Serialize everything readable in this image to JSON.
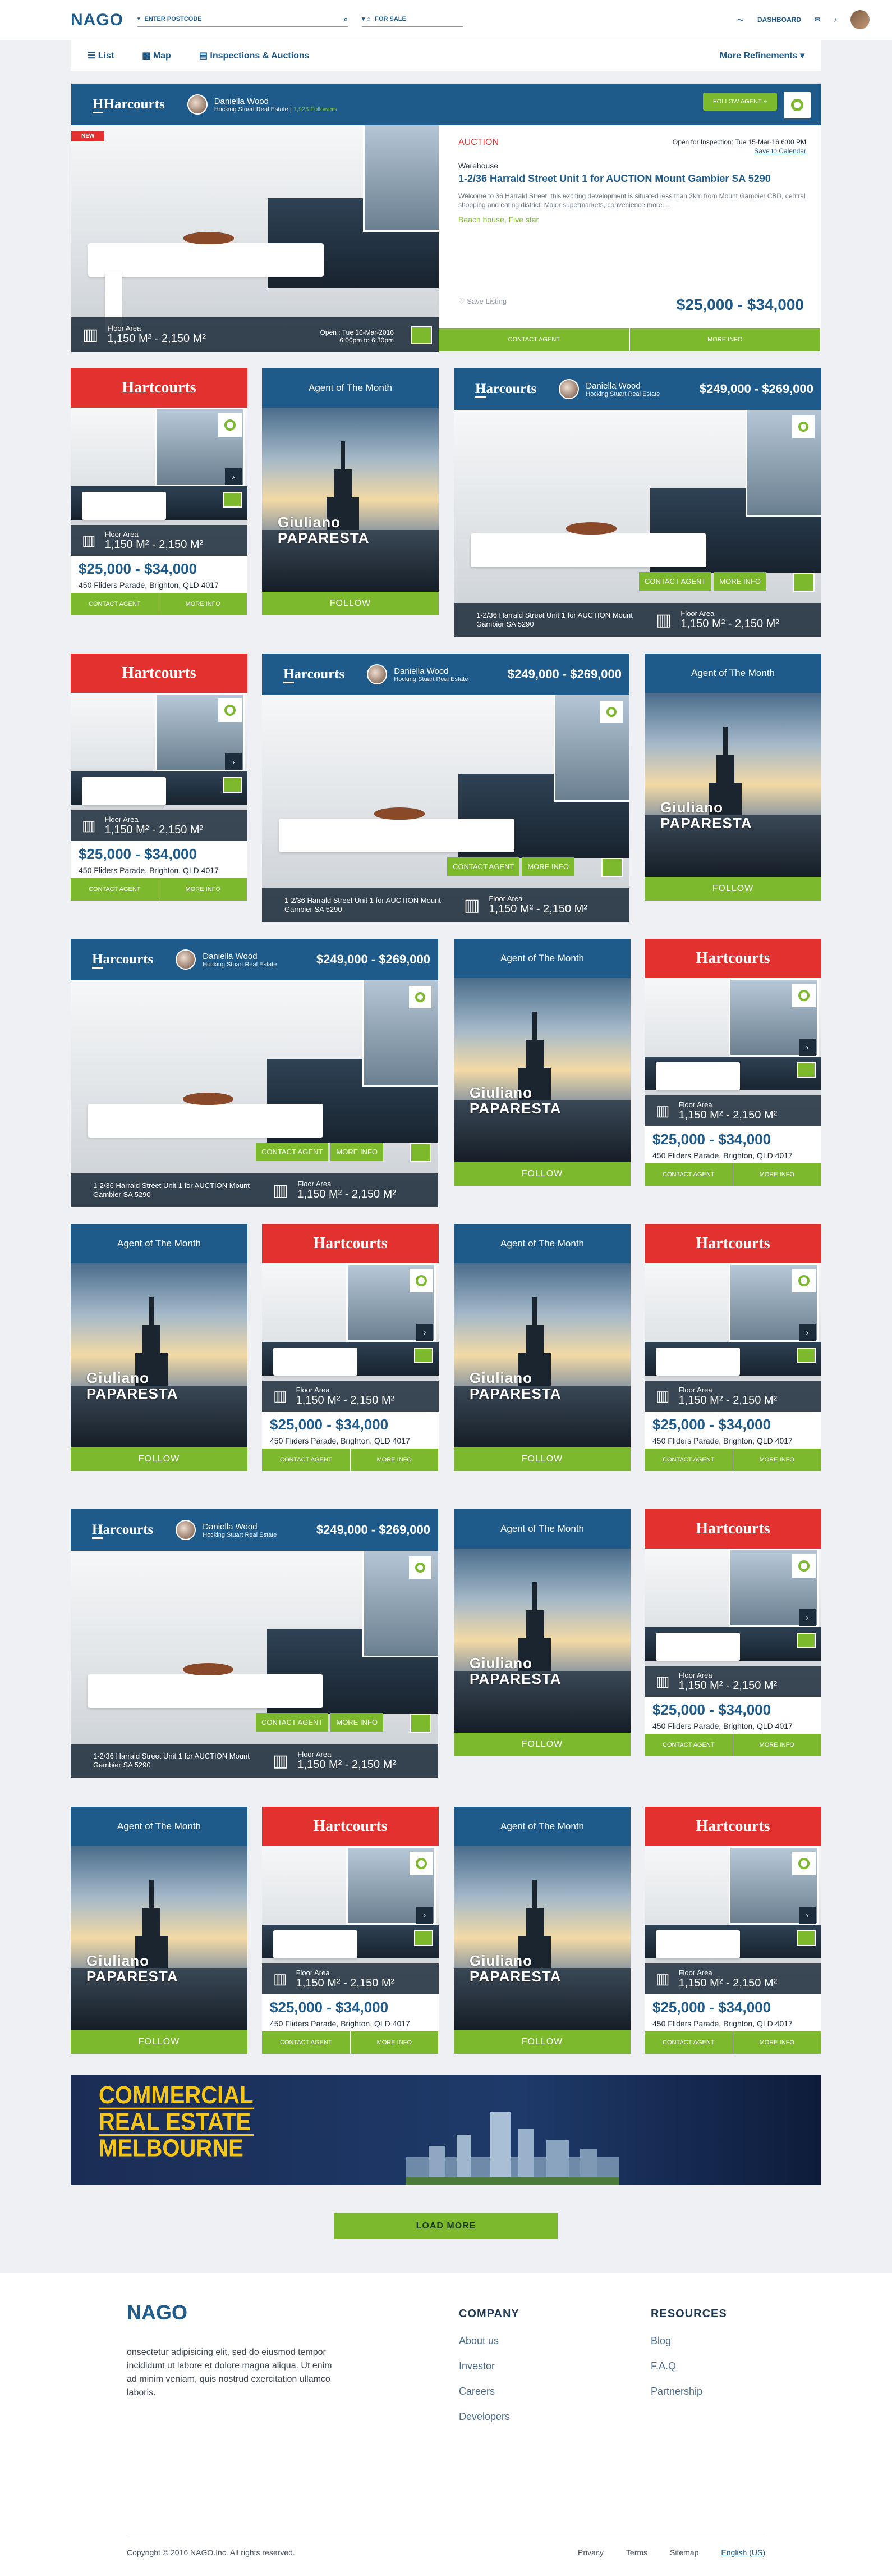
{
  "nav": {
    "logo": "NAGO",
    "postcode_placeholder": "ENTER POSTCODE",
    "sale": "FOR SALE",
    "dashboard": "DASHBOARD"
  },
  "subnav": {
    "list": "List",
    "map": "Map",
    "inspections": "Inspections & Auctions",
    "refine": "More Refinements"
  },
  "hero": {
    "brand": "Harcourts",
    "agent": "Daniella Wood",
    "company": "Hocking Stuart Real Estate",
    "followers": "1,923 Followers",
    "follow_btn": "FOLLOW AGENT +",
    "new": "NEW",
    "floor_label": "Floor Area",
    "floor_value": "1,150 M² - 2,150 M²",
    "open": "Open : Tue 10-Mar-2016",
    "open_time": "6:00pm to 6:30pm",
    "auction": "AUCTION",
    "inspection": "Open for Inspection: Tue 15-Mar-16 6:00 PM",
    "calendar": "Save to Calendar",
    "type": "Warehouse",
    "title": "1-2/36 Harrald Street Unit 1 for AUCTION Mount Gambier SA 5290",
    "desc": "Welcome to 36 Harrald Street, this exciting development is situated less than 2km from Mount Gambier CBD, central shopping and eating district. Major supermarkets, convenience more....",
    "tags": "Beach house, Five star",
    "save": "Save Listing",
    "price": "$25,000 - $34,000",
    "contact": "CONTACT AGENT",
    "more": "MORE INFO"
  },
  "card": {
    "brand": "Hartcourts",
    "floor_label": "Floor Area",
    "floor_value": "1,150 M² - 2,150 M²",
    "price": "$25,000 - $34,000",
    "address": "450 Fliders Parade, Brighton, QLD 4017",
    "contact": "CONTACT AGENT",
    "more": "MORE INFO"
  },
  "agentcard": {
    "title": "Agent of The Month",
    "first": "Giuliano",
    "last": "PAPARESTA",
    "follow": "FOLLOW"
  },
  "widecard": {
    "brand": "Harcourts",
    "agent": "Daniella Wood",
    "company": "Hocking Stuart Real Estate",
    "price": "$249,000 - $269,000",
    "title": "1-2/36 Harrald Street Unit 1 for AUCTION Mount Gambier SA 5290",
    "floor_label": "Floor Area",
    "floor_value": "1,150 M² - 2,150 M²",
    "contact": "CONTACT AGENT",
    "more": "MORE INFO"
  },
  "banner": {
    "l1": "COMMERCIAL",
    "l2": "REAL ESTATE",
    "l3": "MELBOURNE"
  },
  "load_more": "LOAD MORE",
  "footer": {
    "logo": "NAGO",
    "text": "onsectetur adipisicing elit, sed do eiusmod tempor incididunt ut labore et dolore magna aliqua. Ut enim ad minim veniam, quis nostrud exercitation ullamco laboris.",
    "company_h": "COMPANY",
    "company": [
      "About us",
      "Investor",
      "Careers",
      "Developers"
    ],
    "resources_h": "RESOURCES",
    "resources": [
      "Blog",
      "F.A.Q",
      "Partnership"
    ],
    "copyright": "Copyright © 2016 NAGO.Inc. All rights reserved.",
    "links": [
      "Privacy",
      "Terms",
      "Sitemap",
      "English (US)"
    ]
  },
  "colors": {
    "brand": "#1e5a8a",
    "accent": "#7cb92c",
    "red": "#e2312f"
  }
}
